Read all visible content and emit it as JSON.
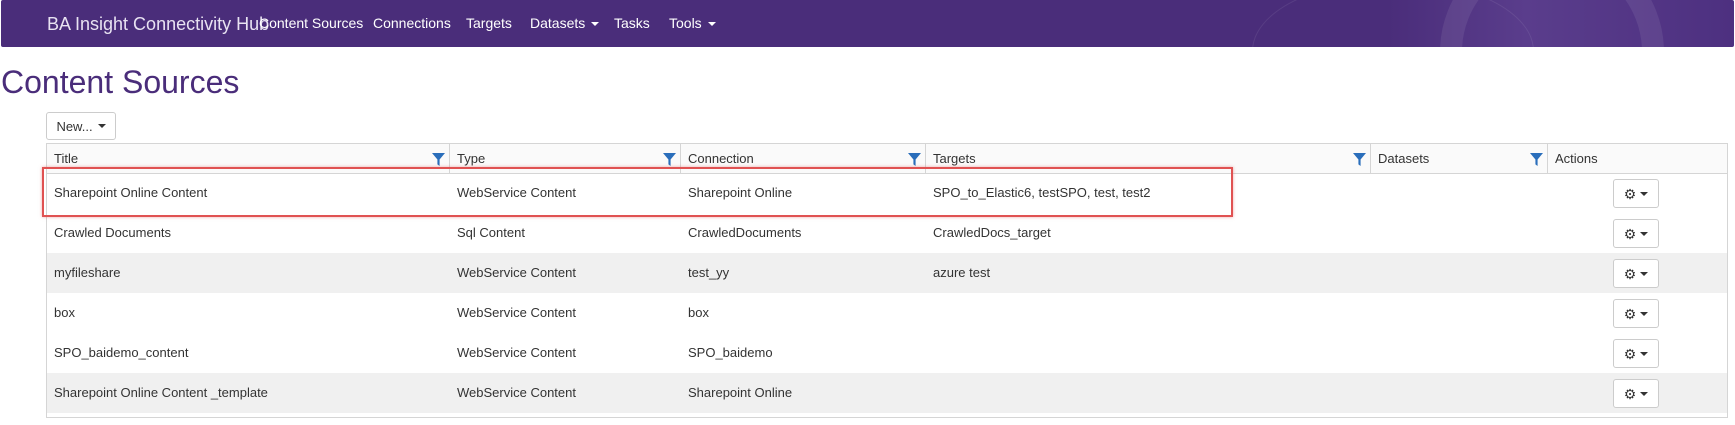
{
  "navbar": {
    "brand": "BA Insight Connectivity Hub",
    "items": [
      {
        "label": "Content Sources",
        "dropdown": false
      },
      {
        "label": "Connections",
        "dropdown": false
      },
      {
        "label": "Targets",
        "dropdown": false
      },
      {
        "label": "Datasets",
        "dropdown": true
      },
      {
        "label": "Tasks",
        "dropdown": false
      },
      {
        "label": "Tools",
        "dropdown": true
      }
    ]
  },
  "page": {
    "title": "Content Sources",
    "new_button_label": "New..."
  },
  "grid": {
    "columns": [
      "Title",
      "Type",
      "Connection",
      "Targets",
      "Datasets",
      "Actions"
    ],
    "rows": [
      {
        "title": "Sharepoint Online Content",
        "type": "WebService Content",
        "connection": "Sharepoint Online",
        "targets": "SPO_to_Elastic6, testSPO, test, test2",
        "datasets": ""
      },
      {
        "title": "Crawled Documents",
        "type": "Sql Content",
        "connection": "CrawledDocuments",
        "targets": "CrawledDocs_target",
        "datasets": ""
      },
      {
        "title": "myfileshare",
        "type": "WebService Content",
        "connection": "test_yy",
        "targets": "azure test",
        "datasets": ""
      },
      {
        "title": "box",
        "type": "WebService Content",
        "connection": "box",
        "targets": "",
        "datasets": ""
      },
      {
        "title": "SPO_baidemo_content",
        "type": "WebService Content",
        "connection": "SPO_baidemo",
        "targets": "",
        "datasets": ""
      },
      {
        "title": "Sharepoint Online Content _template",
        "type": "WebService Content",
        "connection": "Sharepoint Online",
        "targets": "",
        "datasets": ""
      }
    ]
  },
  "icons": {
    "filter": "filter-icon",
    "gear": "gear-icon",
    "caret": "caret-down-icon"
  },
  "colors": {
    "navbar": "#4a2d7a",
    "title": "#4a2d7a",
    "filter_icon": "#2a6ebb",
    "highlight": "#e05252",
    "row_alt": "#f0f0f0"
  }
}
